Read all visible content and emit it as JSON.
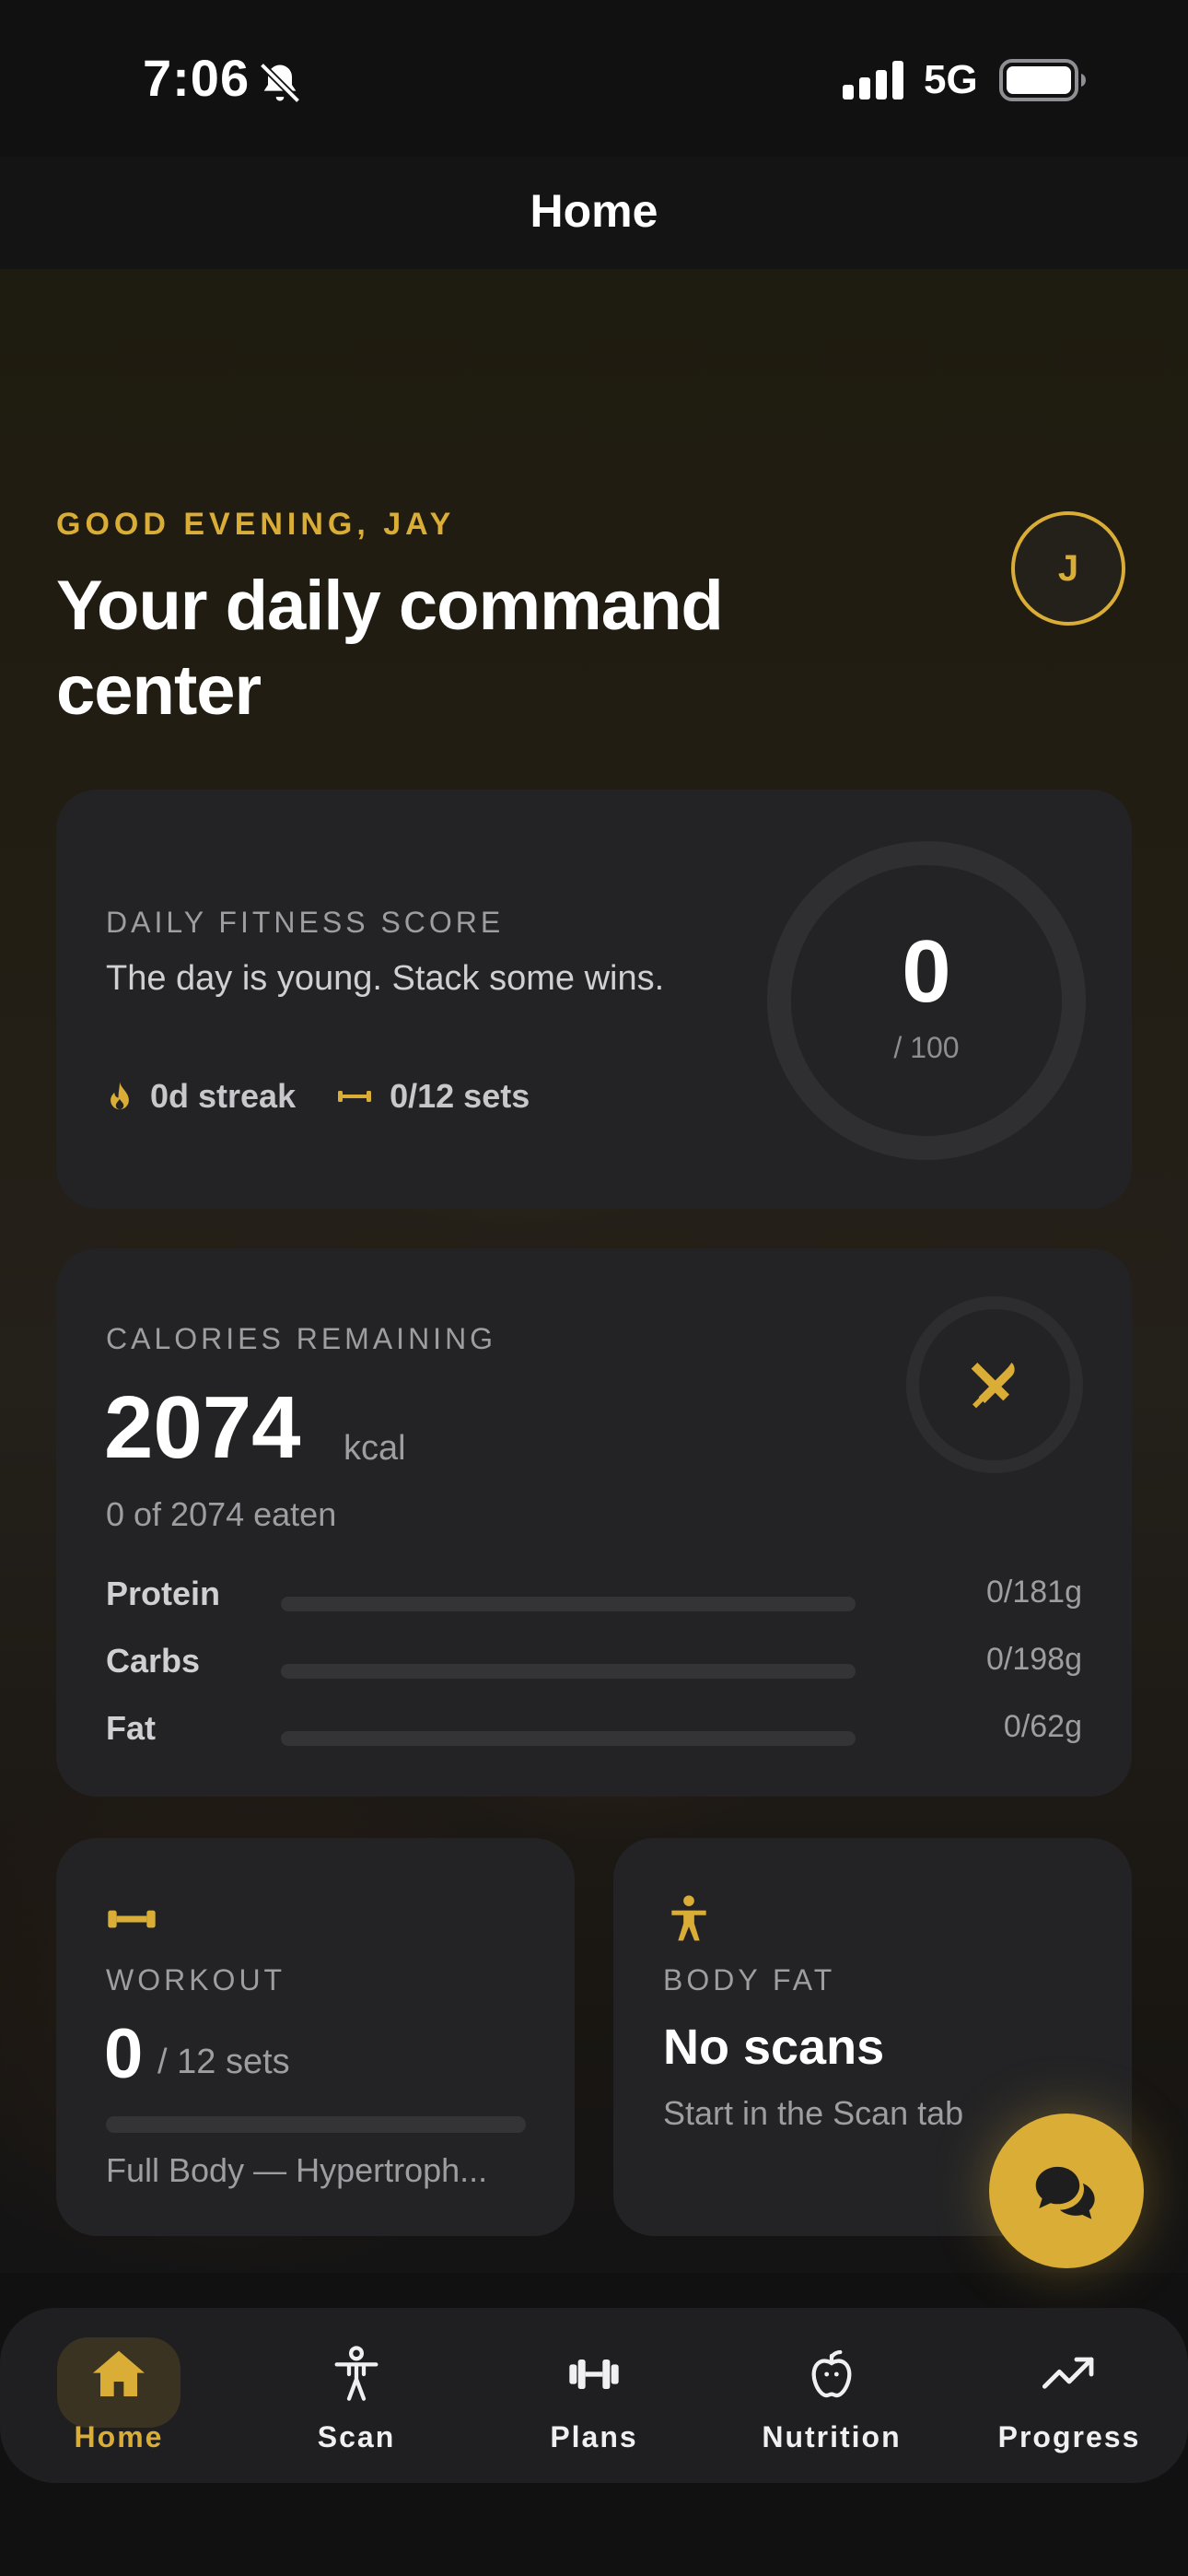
{
  "status_bar": {
    "time": "7:06",
    "network": "5G"
  },
  "header": {
    "title": "Home"
  },
  "hero": {
    "greeting": "GOOD EVENING, JAY",
    "headline": "Your daily command center",
    "avatar_initial": "J"
  },
  "fitness_score": {
    "label": "DAILY FITNESS SCORE",
    "description": "The day is young. Stack some wins.",
    "streak": "0d streak",
    "sets": "0/12 sets",
    "value": "0",
    "max": "/ 100",
    "progress": 0
  },
  "calories": {
    "label": "CALORIES REMAINING",
    "value": "2074",
    "unit": "kcal",
    "eaten": "0 of 2074 eaten",
    "macros": [
      {
        "name": "Protein",
        "amount": "0/181g",
        "progress": 0
      },
      {
        "name": "Carbs",
        "amount": "0/198g",
        "progress": 0
      },
      {
        "name": "Fat",
        "amount": "0/62g",
        "progress": 0
      }
    ]
  },
  "workout": {
    "label": "WORKOUT",
    "value": "0",
    "total": "/ 12 sets",
    "plan": "Full Body — Hypertroph...",
    "progress": 0
  },
  "body_fat": {
    "label": "BODY FAT",
    "value": "No scans",
    "subtitle": "Start in the Scan tab"
  },
  "tabs": [
    {
      "label": "Home",
      "icon": "home-icon",
      "active": true
    },
    {
      "label": "Scan",
      "icon": "person-icon",
      "active": false
    },
    {
      "label": "Plans",
      "icon": "dumbbell-icon",
      "active": false
    },
    {
      "label": "Nutrition",
      "icon": "apple-icon",
      "active": false
    },
    {
      "label": "Progress",
      "icon": "trend-icon",
      "active": false
    }
  ],
  "colors": {
    "accent": "#d9ad36",
    "card": "#232325",
    "background": "#111111"
  }
}
